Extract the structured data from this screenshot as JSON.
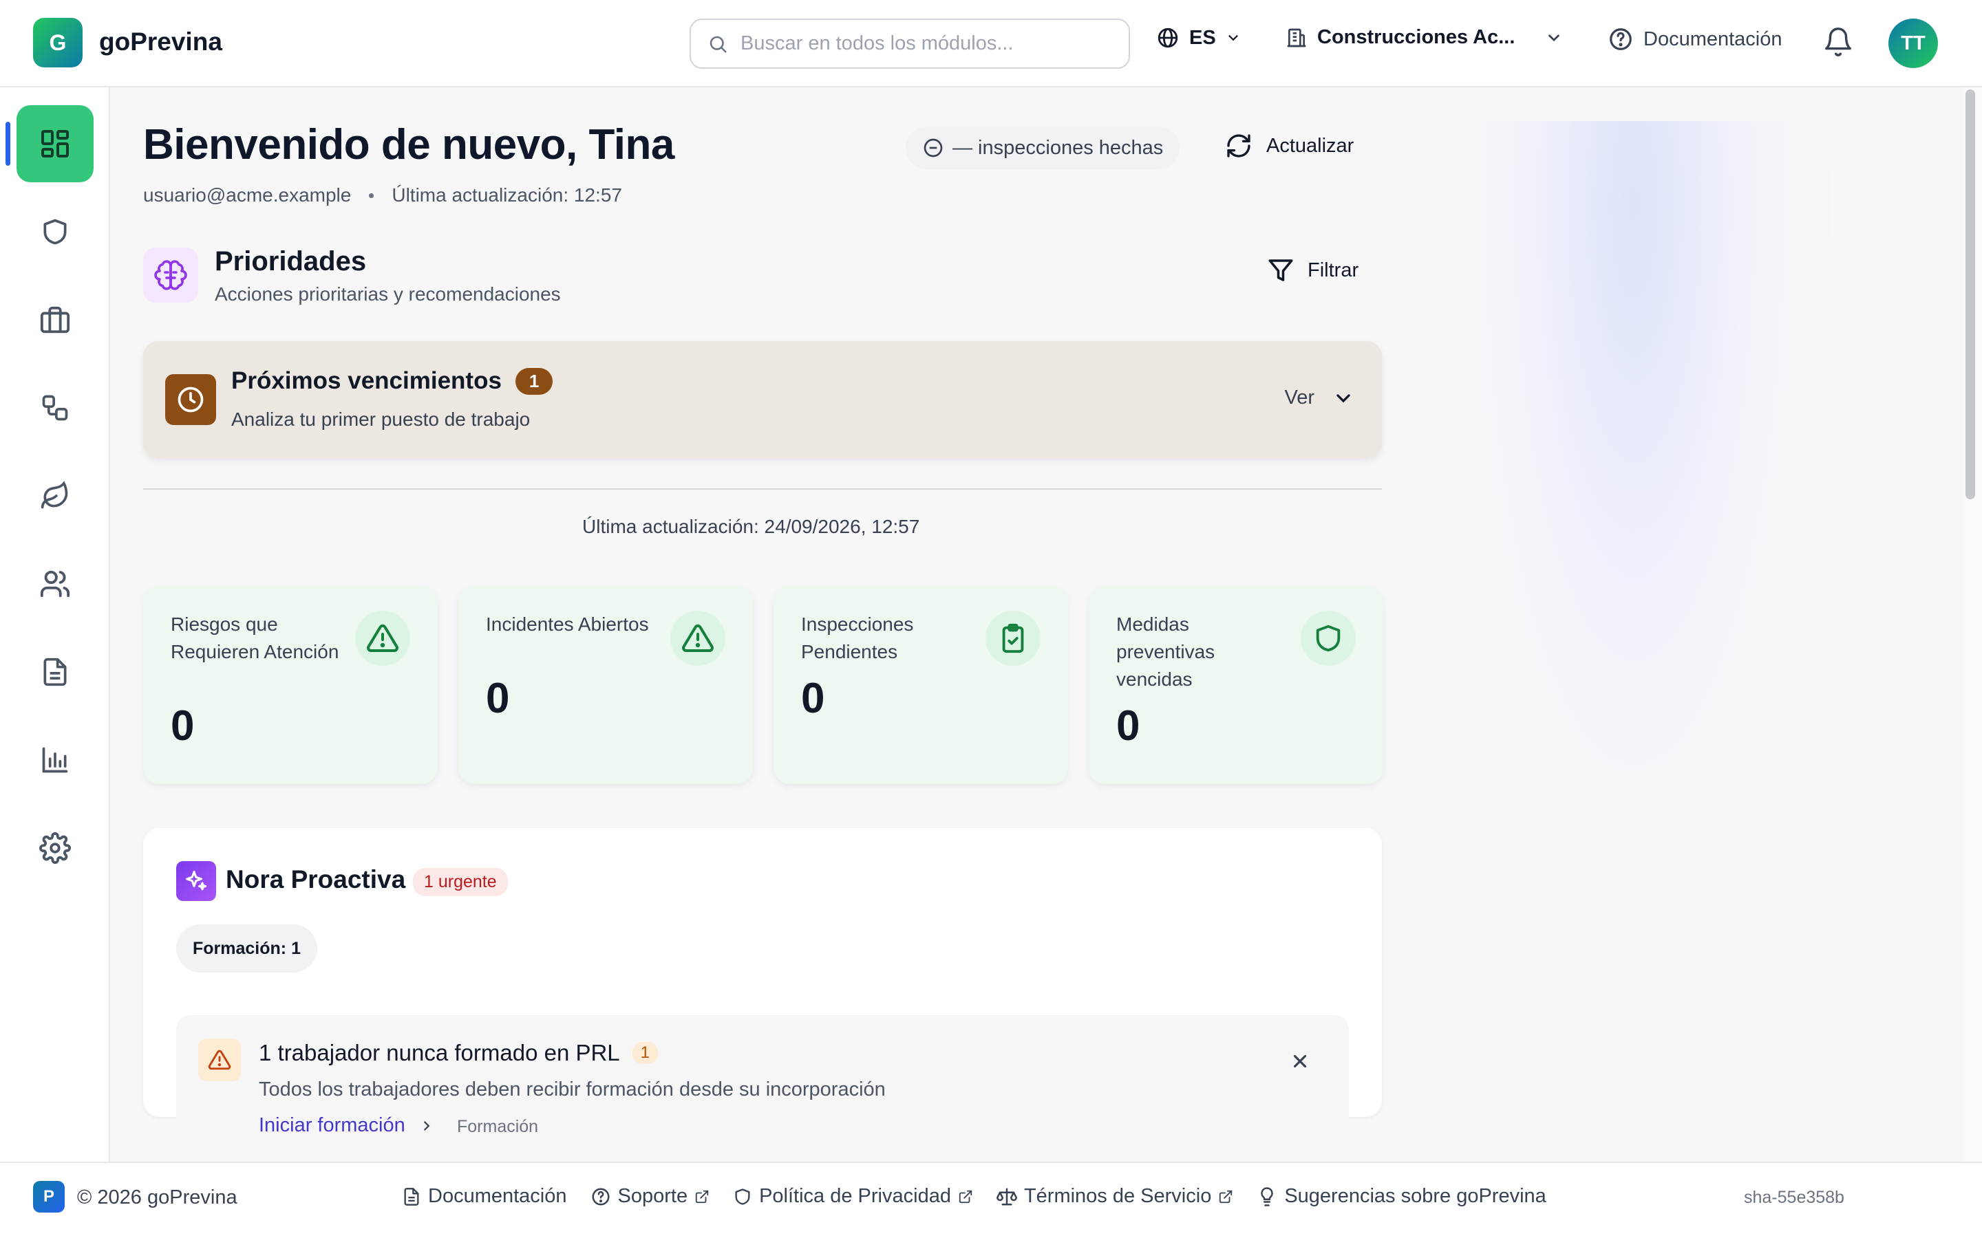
{
  "header": {
    "logo_letter": "G",
    "brand": "goPrevina",
    "search_placeholder": "Buscar en todos los módulos...",
    "language": "ES",
    "company": "Construcciones Ac...",
    "docs_label": "Documentación",
    "avatar_initials": "TT"
  },
  "sidebar": {
    "items": [
      {
        "icon": "dashboard-icon",
        "active": true
      },
      {
        "icon": "shield-icon",
        "active": false
      },
      {
        "icon": "briefcase-icon",
        "active": false
      },
      {
        "icon": "workflow-icon",
        "active": false
      },
      {
        "icon": "leaf-icon",
        "active": false
      },
      {
        "icon": "users-icon",
        "active": false
      },
      {
        "icon": "document-icon",
        "active": false
      },
      {
        "icon": "chart-icon",
        "active": false
      },
      {
        "icon": "settings-icon",
        "active": false
      }
    ]
  },
  "main": {
    "greeting": "Bienvenido de nuevo, Tina",
    "email": "usuario@acme.example",
    "last_update_header": "Última actualización: 12:57",
    "inspections_pill": "— inspecciones hechas",
    "refresh_label": "Actualizar",
    "priorities": {
      "title": "Prioridades",
      "subtitle": "Acciones prioritarias y recomendaciones",
      "filter_label": "Filtrar"
    },
    "due": {
      "title": "Próximos vencimientos",
      "count": "1",
      "subtitle": "Analiza tu primer puesto de trabajo",
      "toggle_label": "Ver"
    },
    "last_update_full": "Última actualización: 24/09/2026, 12:57",
    "stats": [
      {
        "label": "Riesgos que Requieren Atención",
        "value": "0",
        "icon": "warning-icon"
      },
      {
        "label": "Incidentes Abiertos",
        "value": "0",
        "icon": "warning-icon"
      },
      {
        "label": "Inspecciones Pendientes",
        "value": "0",
        "icon": "clipboard-check-icon"
      },
      {
        "label": "Medidas preventivas vencidas",
        "value": "0",
        "icon": "shield-icon"
      }
    ],
    "nora": {
      "title": "Nora Proactiva",
      "urgent_badge": "1 urgente",
      "chip": "Formación: 1",
      "alert": {
        "title": "1 trabajador nunca formado en PRL",
        "count": "1",
        "subtitle": "Todos los trabajadores deben recibir formación desde su incorporación",
        "link": "Iniciar formación",
        "tag": "Formación"
      }
    }
  },
  "footer": {
    "logo_letter": "P",
    "copyright": "© 2026 goPrevina",
    "links": {
      "docs": "Documentación",
      "support": "Soporte",
      "privacy": "Política de Privacidad",
      "terms": "Términos de Servicio",
      "suggestions": "Sugerencias sobre goPrevina"
    },
    "sha": "sha-55e358b"
  },
  "colors": {
    "accent_green": "#34c77b",
    "due_brown": "#8b4d13",
    "link_indigo": "#4338ca",
    "urgent_red": "#b91c1c"
  }
}
